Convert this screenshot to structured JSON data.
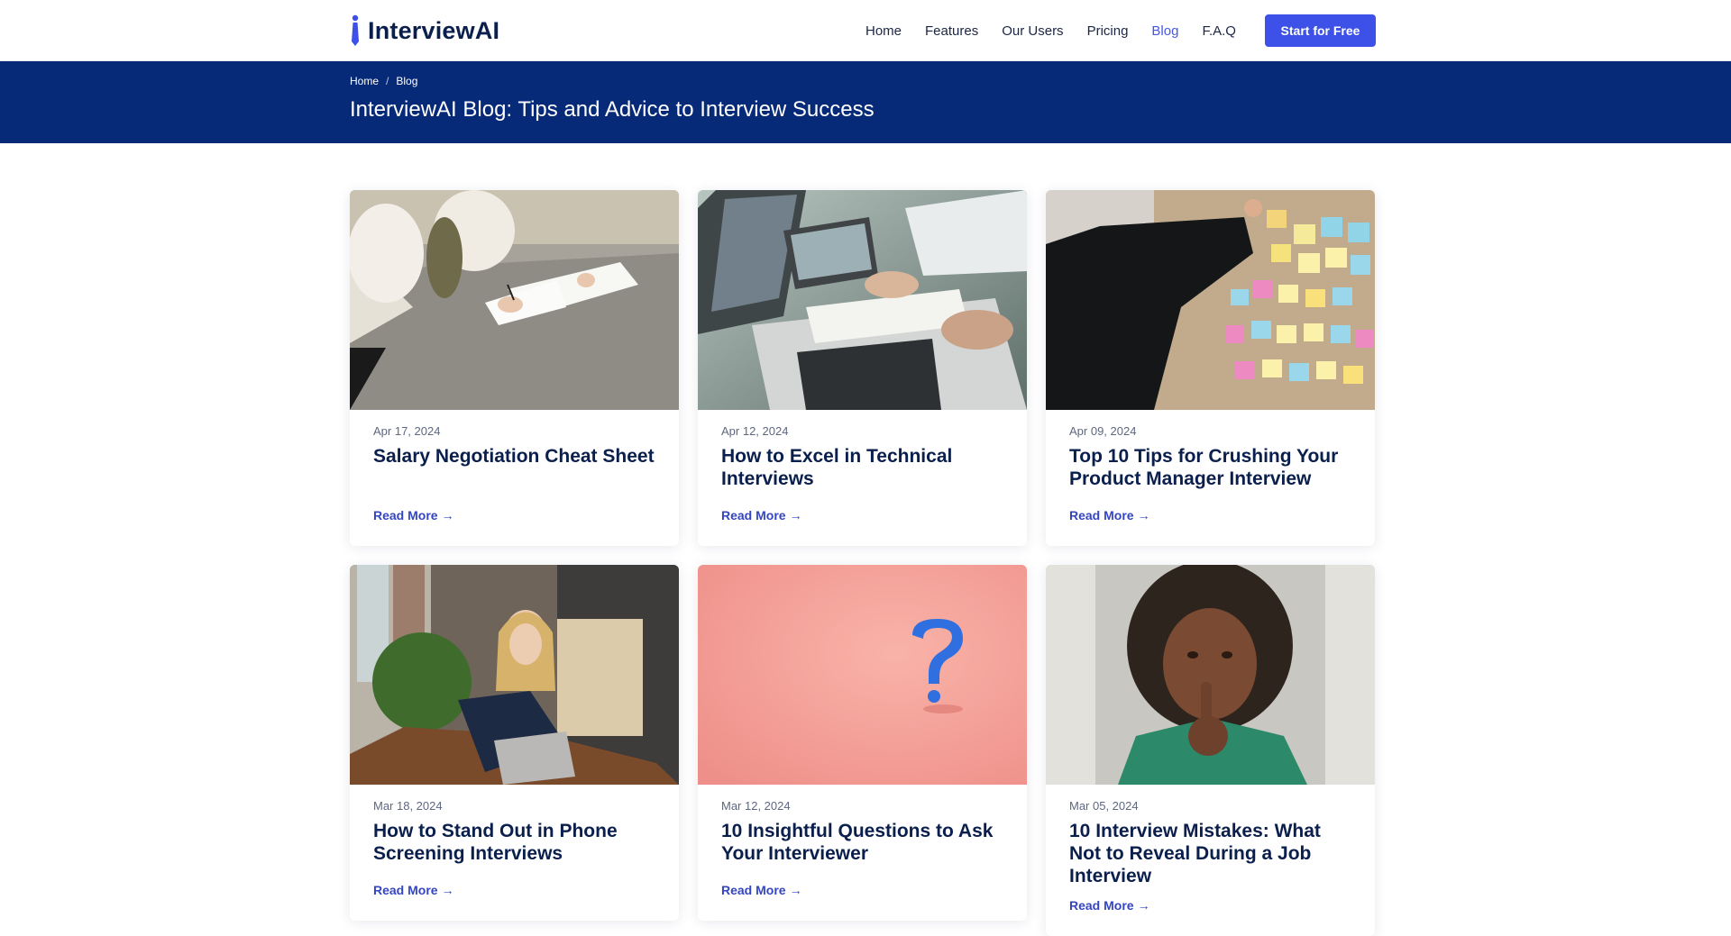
{
  "brand": {
    "name": "InterviewAI",
    "accent": "#3d51e8",
    "hero_bg": "#062a78"
  },
  "nav": {
    "links": [
      "Home",
      "Features",
      "Our Users",
      "Pricing",
      "Blog",
      "F.A.Q"
    ],
    "active": "Blog",
    "cta_label": "Start for Free"
  },
  "breadcrumb": {
    "home": "Home",
    "separator": "/",
    "current": "Blog"
  },
  "page_title": "InterviewAI Blog: Tips and Advice to Interview Success",
  "posts": [
    {
      "date": "Apr 17, 2024",
      "title": "Salary Negotiation Cheat Sheet",
      "read_more": "Read More",
      "image_icon": "people-signing-documents-image"
    },
    {
      "date": "Apr 12, 2024",
      "title": "How to Excel in Technical Interviews",
      "read_more": "Read More",
      "image_icon": "laptop-notes-image"
    },
    {
      "date": "Apr 09, 2024",
      "title": "Top 10 Tips for Crushing Your Product Manager Interview",
      "read_more": "Read More",
      "image_icon": "sticky-notes-board-image"
    },
    {
      "date": "Mar 18, 2024",
      "title": "How to Stand Out in Phone Screening Interviews",
      "read_more": "Read More",
      "image_icon": "woman-on-phone-image"
    },
    {
      "date": "Mar 12, 2024",
      "title": "10 Insightful Questions to Ask Your Interviewer",
      "read_more": "Read More",
      "image_icon": "question-mark-image"
    },
    {
      "date": "Mar 05, 2024",
      "title": "10 Interview Mistakes: What Not to Reveal During a Job Interview",
      "read_more": "Read More",
      "image_icon": "woman-shush-image"
    }
  ]
}
